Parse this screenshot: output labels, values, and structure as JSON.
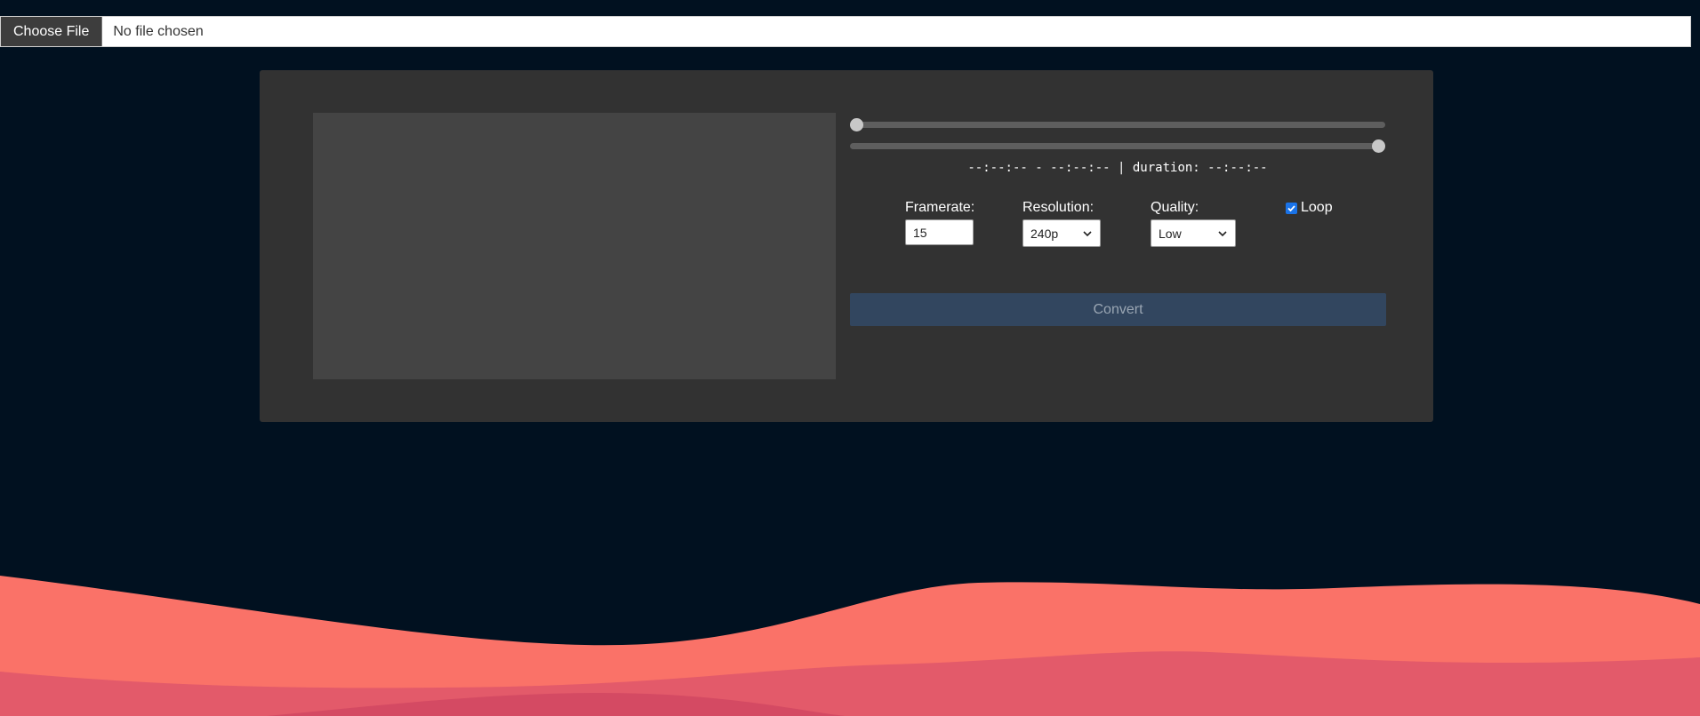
{
  "file_input": {
    "button_label": "Choose File",
    "status_text": "No file chosen"
  },
  "trim": {
    "start_time": "--:--:--",
    "separator": "-",
    "end_time": "--:--:--",
    "divider": "|",
    "duration_label": "duration:",
    "duration_value": "--:--:--",
    "start_position": 0,
    "end_position": 1
  },
  "settings": {
    "framerate": {
      "label": "Framerate:",
      "value": "15"
    },
    "resolution": {
      "label": "Resolution:",
      "value": "240p"
    },
    "quality": {
      "label": "Quality:",
      "value": "Low"
    },
    "loop": {
      "label": "Loop",
      "checked": true
    }
  },
  "actions": {
    "convert_label": "Convert"
  },
  "colors": {
    "page_background": "#011120",
    "panel_background": "#323232",
    "preview_background": "#444444",
    "convert_button": "#32465f",
    "wave_front": "#fa7268",
    "wave_mid": "#e35a6a",
    "wave_back": "#d44a63"
  }
}
